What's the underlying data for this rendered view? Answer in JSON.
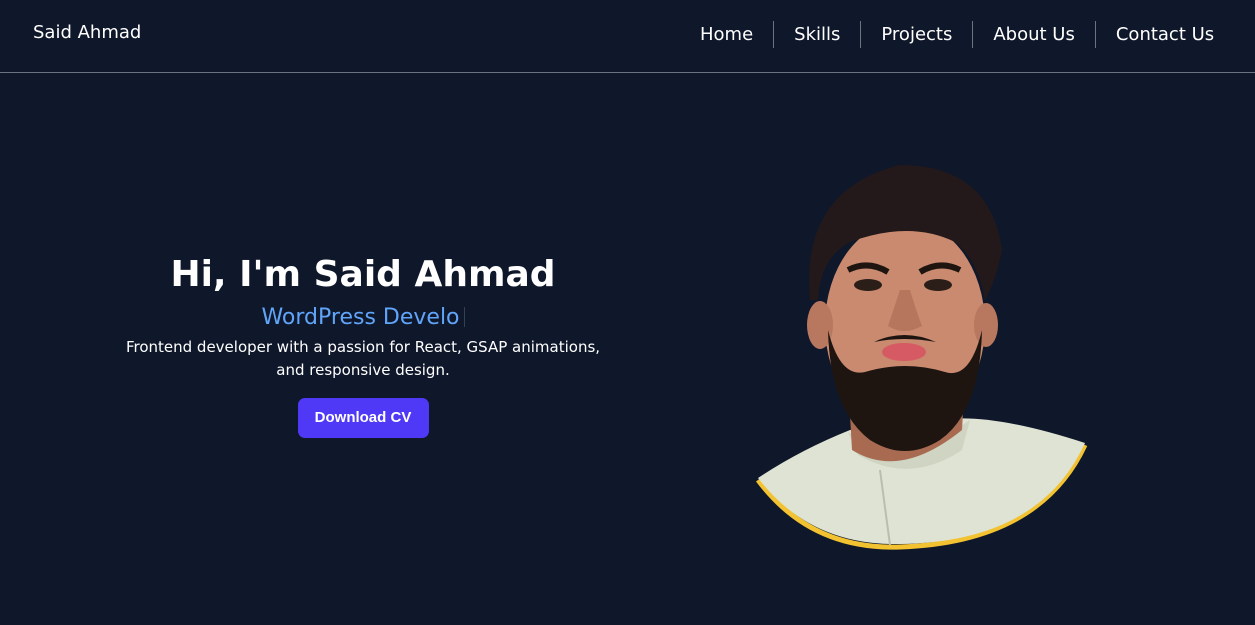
{
  "header": {
    "brand": "Said Ahmad",
    "nav": [
      {
        "label": "Home"
      },
      {
        "label": "Skills"
      },
      {
        "label": "Projects"
      },
      {
        "label": "About Us"
      },
      {
        "label": "Contact Us"
      }
    ]
  },
  "hero": {
    "title": "Hi, I'm Said Ahmad",
    "role_typed": "WordPress Develo",
    "description": "Frontend developer with a passion for React, GSAP animations, and responsive design.",
    "cta_label": "Download CV"
  },
  "portrait": {
    "icon": "profile-photo-icon"
  },
  "colors": {
    "background": "#0f172a",
    "accent": "#4f39f6",
    "role_text": "#60a5fa",
    "portrait_ring": "#f2c230"
  }
}
